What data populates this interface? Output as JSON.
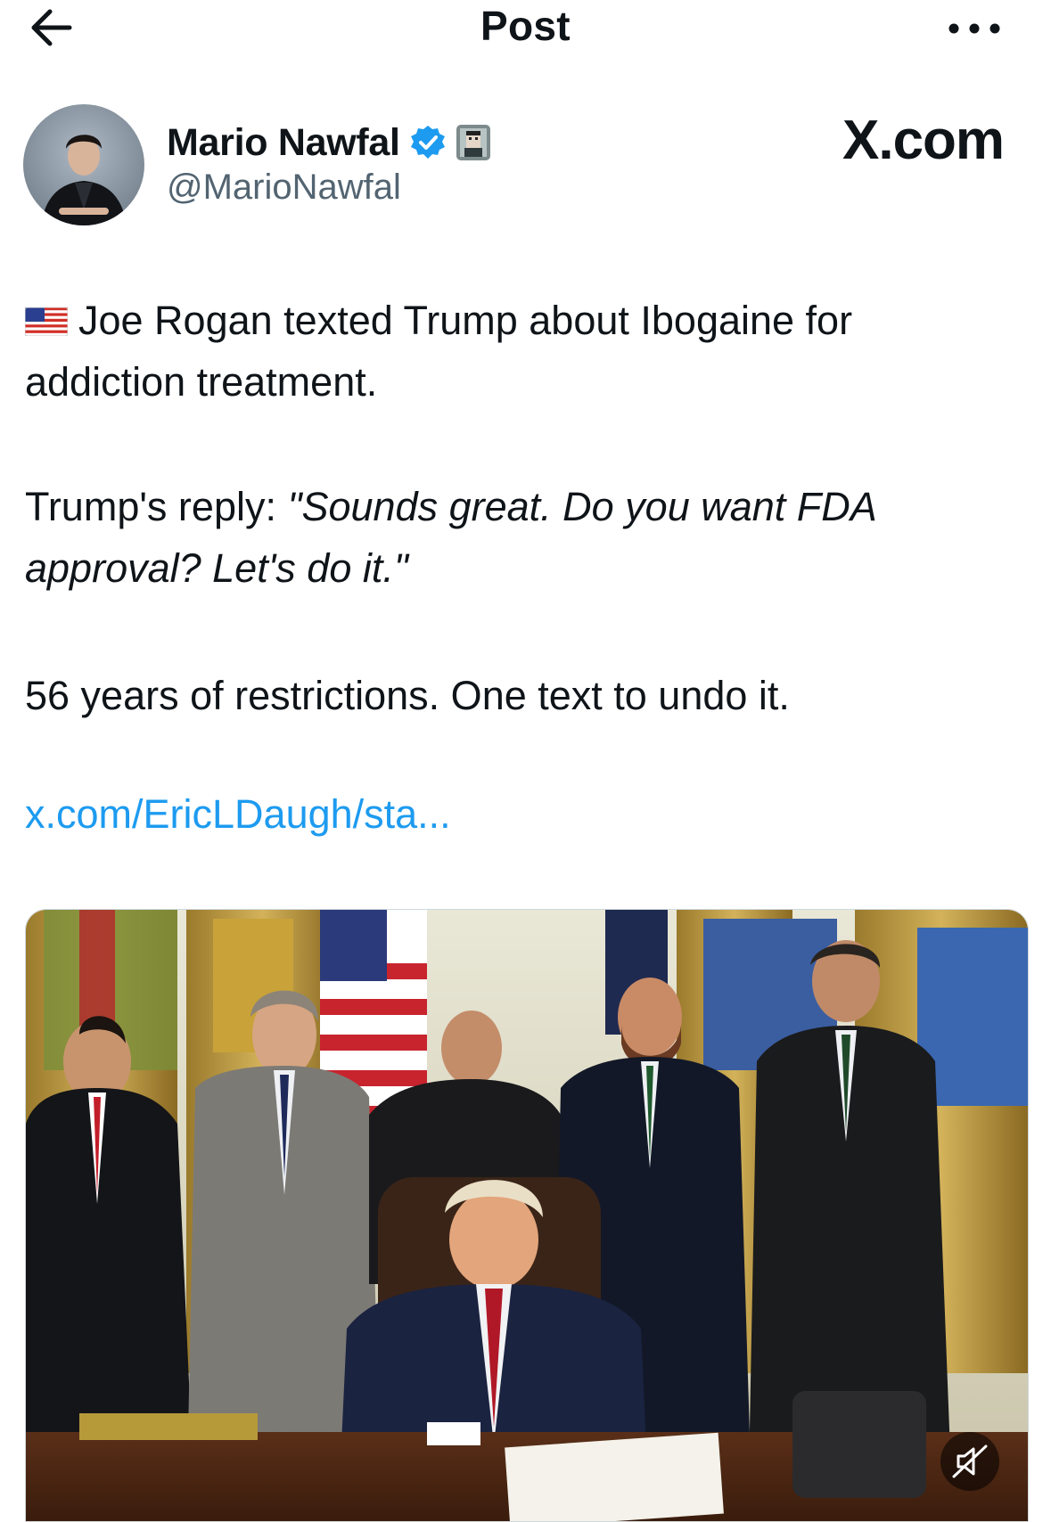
{
  "header": {
    "title": "Post",
    "back_icon": "back-arrow-icon",
    "more_icon": "more-icon"
  },
  "author": {
    "name": "Mario Nawfal",
    "handle": "@MarioNawfal",
    "verified_icon": "verified-badge-icon",
    "badge_icon": "affiliate-badge-icon",
    "watermark": "X.com"
  },
  "post": {
    "line1_flag": "us-flag-icon",
    "paragraph1": "Joe Rogan texted Trump about Ibogaine for addiction treatment.",
    "paragraph2_prefix": "Trump's reply: ",
    "paragraph2_quote": "\"Sounds great. Do you want FDA approval? Let's do it.\"",
    "paragraph3": "56 years of restrictions. One text to undo it.",
    "link": "x.com/EricLDaugh/sta..."
  },
  "media": {
    "type": "video",
    "mute_icon": "muted-speaker-icon"
  },
  "colors": {
    "link": "#1d9bf0",
    "verified": "#1d9bf0",
    "secondary_text": "#536471"
  }
}
